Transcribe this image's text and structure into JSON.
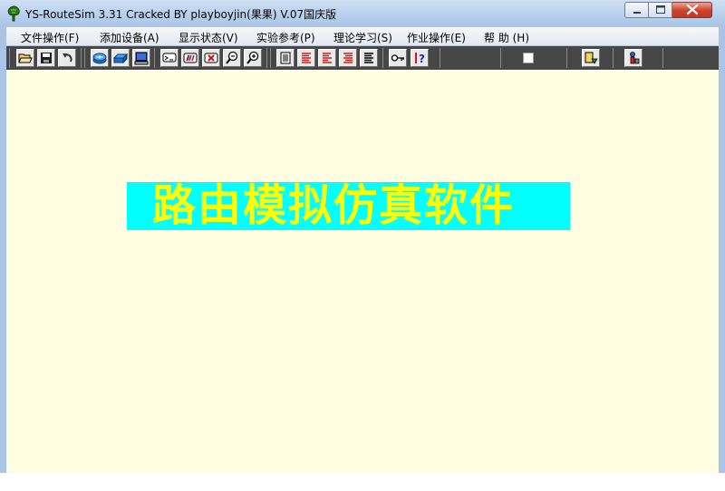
{
  "window": {
    "title": "YS-RouteSim 3.31   Cracked BY playboyjin(果果) V.07国庆版"
  },
  "menu": {
    "items": [
      {
        "label": "文件操作(F)"
      },
      {
        "label": "添加设备(A)"
      },
      {
        "label": "显示状态(V)"
      },
      {
        "label": "实验参考(P)"
      },
      {
        "label": "理论学习(S)"
      },
      {
        "label": "作业操作(E)"
      },
      {
        "label": "帮 助 (H)"
      }
    ]
  },
  "toolbar": {
    "icons": [
      "open-folder-icon",
      "save-icon",
      "undo-icon",
      "router-icon",
      "switch-icon",
      "pc-icon",
      "console-icon",
      "rename-icon",
      "delete-icon",
      "zoom-out-icon",
      "zoom-in-icon",
      "text-list-icon",
      "red-lines-icon",
      "red-lines-alt-icon",
      "red-lines-right-icon",
      "black-lines-icon",
      "key-icon",
      "help-icon",
      "stop-icon",
      "export-icon",
      "user-icon"
    ],
    "colors": {
      "background": "#474747",
      "button": "#e9e9e9"
    }
  },
  "workspace": {
    "banner_text": "路由模拟仿真软件",
    "colors": {
      "background": "#fffee2",
      "banner_bg": "#00ffff",
      "banner_text": "#ffff00"
    }
  }
}
